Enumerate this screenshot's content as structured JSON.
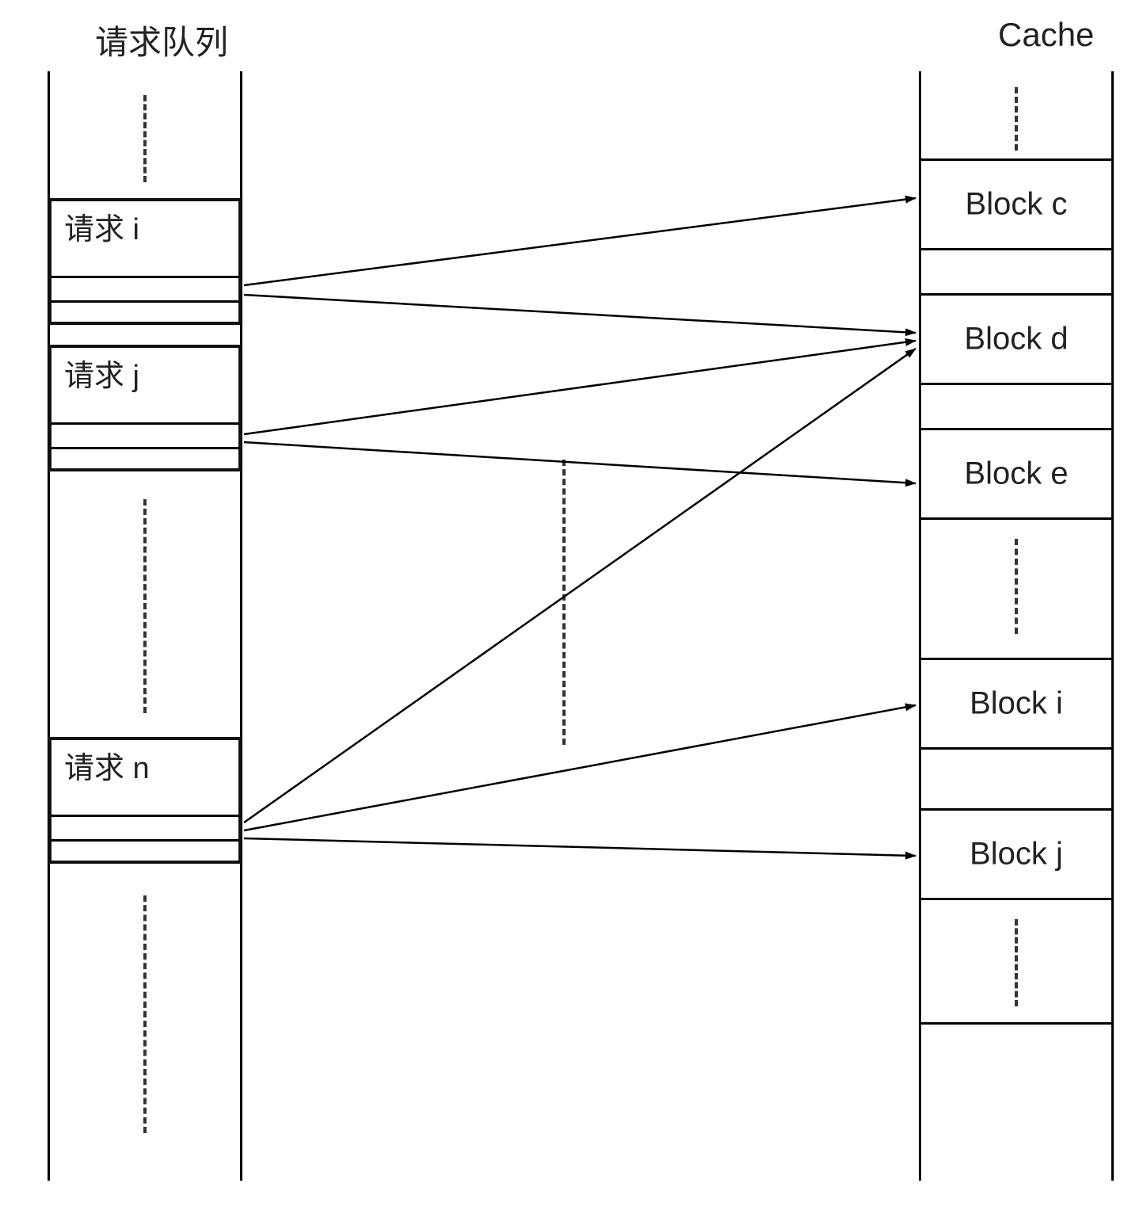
{
  "titles": {
    "queue": "请求队列",
    "cache": "Cache"
  },
  "requests": [
    {
      "label": "请求 i"
    },
    {
      "label": "请求 j"
    },
    {
      "label": "请求 n"
    }
  ],
  "cache_blocks": [
    {
      "label": "Block c"
    },
    {
      "label": "Block d"
    },
    {
      "label": "Block e"
    },
    {
      "label": "Block i"
    },
    {
      "label": "Block j"
    }
  ],
  "mapping": [
    {
      "from": "请求 i",
      "to": [
        "Block c",
        "Block d"
      ]
    },
    {
      "from": "请求 j",
      "to": [
        "Block d",
        "Block e"
      ]
    },
    {
      "from": "请求 n",
      "to": [
        "Block d",
        "Block i",
        "Block j"
      ]
    }
  ]
}
